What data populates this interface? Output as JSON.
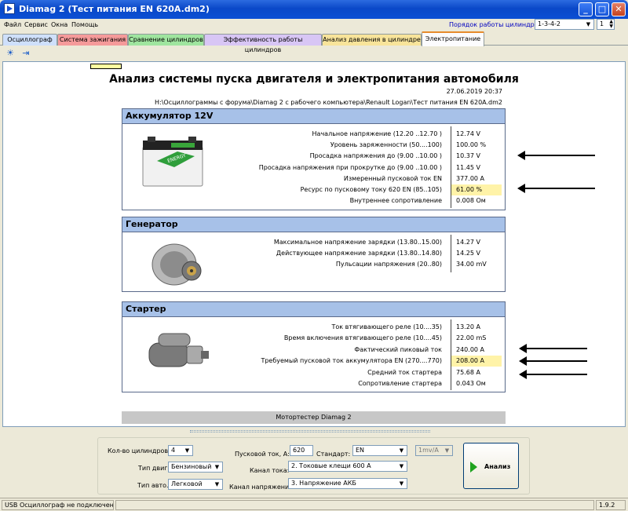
{
  "window": {
    "title": "Diamag 2 (Тест питания EN 620A.dm2)",
    "buttons": {
      "minimize": "_",
      "maximize": "□",
      "close": "✕"
    }
  },
  "menu": [
    "Файл",
    "Сервис",
    "Окна",
    "Помощь"
  ],
  "cylinder_order": {
    "label": "Порядок работы цилиндров",
    "value": "1-3-4-2",
    "spin_value": "1"
  },
  "tabs": [
    {
      "label": "Осциллограф",
      "color": "#cfe0fb"
    },
    {
      "label": "Система зажигания",
      "color": "#f59a9a"
    },
    {
      "label": "Сравнение цилиндров",
      "color": "#9fe59f"
    },
    {
      "label": "Эффективность работы цилиндров",
      "color": "#d8c6f5"
    },
    {
      "label": "Анализ давления в цилиндре",
      "color": "#f8e49a"
    },
    {
      "label": "Электропитание",
      "color": "#fcfcfe"
    }
  ],
  "toolbar_icons": [
    "run-icon",
    "export-icon"
  ],
  "report": {
    "title": "Анализ системы пуска двигателя и электропитания автомобиля",
    "date": "27.06.2019 20:37",
    "path": "H:\\Осциллограммы с форума\\Diamag 2 с рабочего компьютера\\Renault Logan\\Тест питания EN 620A.dm2",
    "battery": {
      "header": "Аккумулятор 12V",
      "rows": [
        {
          "label": "Начальное напряжение (12.20 ..12.70 )",
          "value": "12.74 V"
        },
        {
          "label": "Уровень заряженности (50....100)",
          "value": "100.00 %"
        },
        {
          "label": "Просадка напряжения до (9.00 ..10.00 )",
          "value": "10.37 V"
        },
        {
          "label": "Просадка напряжения при прокрутке до (9.00 ..10.00 )",
          "value": "11.45 V"
        },
        {
          "label": "Измеренный пусковой ток  EN",
          "value": "377.00 A"
        },
        {
          "label": "Ресурс по пусковому току  620 EN (85..105)",
          "value": "61.00 %",
          "highlight": true
        },
        {
          "label": "Внутреннее сопротивление",
          "value": "0.008 Ом"
        }
      ],
      "image_label": "ENERGY"
    },
    "generator": {
      "header": "Генератор",
      "rows": [
        {
          "label": "Максимальное напряжение зарядки  (13.80..15.00)",
          "value": "14.27 V"
        },
        {
          "label": "Действующее напряжение зарядки (13.80..14.80)",
          "value": "14.25 V"
        },
        {
          "label": "Пульсации напряжения (20..80)",
          "value": "34.00 mV"
        }
      ]
    },
    "starter": {
      "header": "Стартер",
      "rows": [
        {
          "label": "Ток втягивающего реле (10....35)",
          "value": "13.20 A"
        },
        {
          "label": "Время включения втягивающего реле (10....45)",
          "value": "22.00 mS"
        },
        {
          "label": "Фактический пиковый ток",
          "value": "240.00 A"
        },
        {
          "label": "Требуемый пусковой ток аккумулятора  EN (270....770)",
          "value": "208.00 A",
          "highlight": true
        },
        {
          "label": "Средний ток стартера",
          "value": "75.68 A"
        },
        {
          "label": "Сопротивление стартера",
          "value": "0.043 Ом"
        }
      ]
    },
    "footer": "Мотортестер Diamag 2"
  },
  "controls": {
    "cylinders_label": "Кол-во цилиндров:",
    "cylinders_value": "4",
    "engine_type_label": "Тип двиг.:",
    "engine_type_value": "Бензиновый",
    "car_type_label": "Тип авто.:",
    "car_type_value": "Легковой",
    "start_current_label": "Пусковой ток, А:",
    "start_current_value": "620",
    "standard_label": "Стандарт:",
    "standard_value": "EN",
    "current_channel_label": "Канал тока:",
    "current_channel_value": "2. Токовые клещи 600 А",
    "voltage_channel_label": "Канал напряжения:",
    "voltage_channel_value": "3. Напряжение АКБ",
    "scale_value": "1mv/A",
    "analyze_label": "Анализ"
  },
  "status": {
    "left": "USB Осциллограф не подключен",
    "version": "1.9.2"
  }
}
